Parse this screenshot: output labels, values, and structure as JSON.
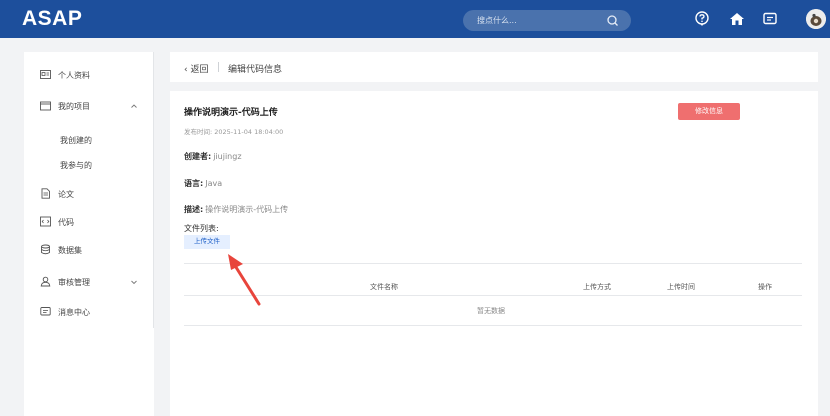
{
  "header": {
    "logo": "ASAP",
    "search_placeholder": "搜点什么...",
    "icons": [
      "search-icon",
      "help-icon",
      "home-icon",
      "message-icon"
    ]
  },
  "sidebar": {
    "items": [
      {
        "label": "个人资料",
        "icon": "id-card-icon"
      },
      {
        "label": "我的项目",
        "icon": "folder-icon",
        "expanded": true
      },
      {
        "label": "我创建的"
      },
      {
        "label": "我参与的"
      },
      {
        "label": "论文",
        "icon": "document-icon"
      },
      {
        "label": "代码",
        "icon": "code-icon"
      },
      {
        "label": "数据集",
        "icon": "database-icon"
      },
      {
        "label": "审核管理",
        "icon": "user-audit-icon",
        "expanded": false
      },
      {
        "label": "消息中心",
        "icon": "message-icon"
      }
    ]
  },
  "breadcrumb": {
    "back": "返回",
    "title": "编辑代码信息"
  },
  "detail": {
    "title": "操作说明演示-代码上传",
    "publish_time": "发布时间: 2025-11-04 18:04:00",
    "edit_button": "修改信息",
    "creator_label": "创建者:",
    "creator_value": "jiujingz",
    "language_label": "语言:",
    "language_value": "Java",
    "description_label": "描述:",
    "description_value": "操作说明演示-代码上传",
    "files_label": "文件列表:",
    "upload_button": "上传文件",
    "table": {
      "columns": [
        "文件名称",
        "上传方式",
        "上传时间",
        "操作"
      ],
      "empty_text": "暂无数据"
    }
  },
  "colors": {
    "topbar": "#1d4f9c",
    "edit_button": "#ef6f6f",
    "upload_button_bg": "#e5efff",
    "annotation_arrow": "#e8453c"
  }
}
